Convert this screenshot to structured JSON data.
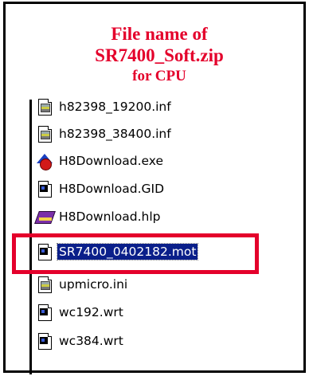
{
  "heading": {
    "line1": "File name of",
    "line2": "SR7400_Soft.zip",
    "line3": "for CPU"
  },
  "files": [
    {
      "name": "h82398_19200.inf",
      "icon": "config-file-icon"
    },
    {
      "name": "h82398_38400.inf",
      "icon": "config-file-icon"
    },
    {
      "name": "H8Download.exe",
      "icon": "application-icon"
    },
    {
      "name": "H8Download.GID",
      "icon": "system-file-icon"
    },
    {
      "name": "H8Download.hlp",
      "icon": "help-book-icon"
    },
    {
      "name": "SR7400_0402182.mot",
      "icon": "system-file-icon",
      "selected": true
    },
    {
      "name": "upmicro.ini",
      "icon": "config-file-icon"
    },
    {
      "name": "wc192.wrt",
      "icon": "system-file-icon"
    },
    {
      "name": "wc384.wrt",
      "icon": "system-file-icon"
    }
  ],
  "colors": {
    "highlight_text": "#e4002b",
    "selection_bg": "#0a1f8a",
    "callout_border": "#e4002b"
  }
}
